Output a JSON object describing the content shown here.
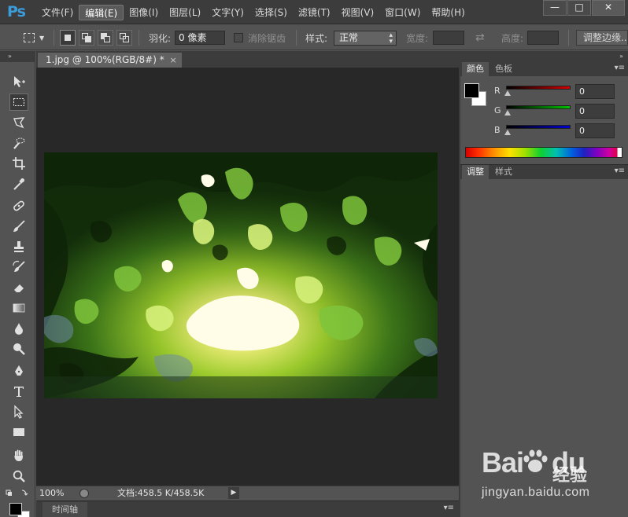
{
  "app": {
    "logo": "Ps",
    "menus": [
      "文件(F)",
      "编辑(E)",
      "图像(I)",
      "图层(L)",
      "文字(Y)",
      "选择(S)",
      "滤镜(T)",
      "视图(V)",
      "窗口(W)",
      "帮助(H)"
    ],
    "active_menu": "编辑(E)",
    "window_buttons": [
      "—",
      "□",
      "✕"
    ]
  },
  "options": {
    "feather_label": "羽化:",
    "feather_value": "0 像素",
    "antialias_label": "消除锯齿",
    "style_label": "样式:",
    "style_value": "正常",
    "width_label": "宽度:",
    "swap_icon": "⇄",
    "height_label": "高度:",
    "refine_edge_button": "调整边缘..."
  },
  "document": {
    "tab_title": "1.jpg @ 100%(RGB/8#) *",
    "close_glyph": "×"
  },
  "status": {
    "zoom": "100%",
    "doc_size": "文档:458.5 K/458.5K",
    "arrow": "▶"
  },
  "timeline": {
    "tab_label": "时间轴",
    "menu_glyph": "▾≡"
  },
  "panels": {
    "collapse_glyph": "»",
    "color_tab": "颜色",
    "swatches_tab": "色板",
    "adjust_tab": "调整",
    "styles_tab": "样式",
    "menu_glyph": "▾≡",
    "channels": [
      {
        "label": "R",
        "value": "0",
        "color": "#d40000"
      },
      {
        "label": "G",
        "value": "0",
        "color": "#00c000"
      },
      {
        "label": "B",
        "value": "0",
        "color": "#0000d0"
      }
    ]
  },
  "colors": {
    "foreground": "#000000",
    "background": "#ffffff"
  },
  "watermark": {
    "brand_left": "Bai",
    "brand_right": "du",
    "sub": "经验",
    "url": "jingyan.baidu.com"
  }
}
